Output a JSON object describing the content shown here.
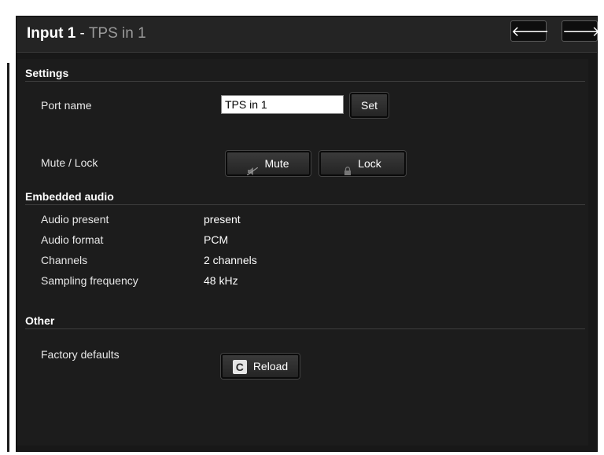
{
  "header": {
    "input_label": "Input 1",
    "separator": " - ",
    "port_label": "TPS in 1",
    "prev_icon": "arrow-left-icon",
    "next_icon": "arrow-right-icon",
    "prev_glyph": "🡐",
    "next_glyph": "🡒"
  },
  "settings": {
    "title": "Settings",
    "port_name_label": "Port name",
    "port_name_value": "TPS in 1",
    "set_label": "Set",
    "mute_lock_label": "Mute / Lock",
    "mute_label": "Mute",
    "lock_label": "Lock"
  },
  "embedded_audio": {
    "title": "Embedded audio",
    "rows": [
      {
        "label": "Audio present",
        "value": "present"
      },
      {
        "label": "Audio format",
        "value": "PCM"
      },
      {
        "label": "Channels",
        "value": "2 channels"
      },
      {
        "label": "Sampling frequency",
        "value": "48 kHz"
      }
    ]
  },
  "other": {
    "title": "Other",
    "factory_defaults_label": "Factory defaults",
    "reload_label": "Reload",
    "reload_icon_glyph": "C"
  },
  "colors": {
    "background": "#181818",
    "title_port": "#9a9a9a"
  }
}
